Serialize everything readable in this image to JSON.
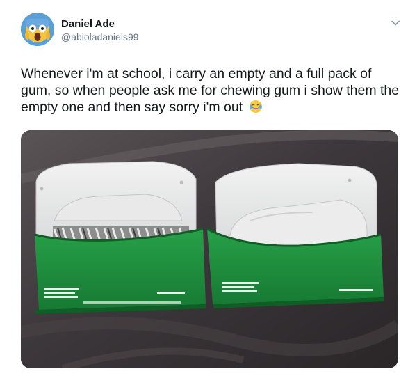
{
  "tweet": {
    "display_name": "Daniel Ade",
    "handle": "@abioladaniels99",
    "text": "Whenever i'm at school, i carry an empty and a full pack of gum, so when people ask me for chewing gum i show them the empty one and then say sorry i'm out",
    "emoji": "face-with-tears-of-joy",
    "menu_icon": "chevron-down-icon"
  },
  "photo": {
    "subject": "two green gum packs, one full and one empty"
  },
  "colors": {
    "text": "#14171a",
    "secondary": "#657786",
    "gum_pack_green": "#1e8a3a"
  }
}
